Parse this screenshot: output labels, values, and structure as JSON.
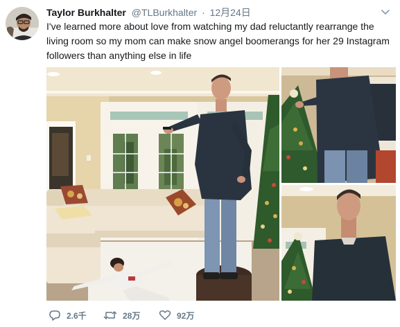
{
  "author": {
    "display_name": "Taylor Burkhalter",
    "handle": "@TLBurkhalter",
    "separator": "·",
    "date": "12月24日"
  },
  "tweet": {
    "text": "I've learned more about love from watching my dad reluctantly rearrange the living room so my mom can make snow angel boomerangs for her 29 Instagram followers than anything else in life"
  },
  "media": {
    "photo_count": 3
  },
  "actions": {
    "reply_count": "2.6千",
    "retweet_count": "28万",
    "like_count": "92万"
  },
  "icons": {
    "reply": "reply-icon",
    "retweet": "retweet-icon",
    "like": "heart-icon",
    "more": "chevron-down-icon"
  },
  "colors": {
    "text": "#14171a",
    "secondary": "#657786",
    "background": "#ffffff"
  }
}
